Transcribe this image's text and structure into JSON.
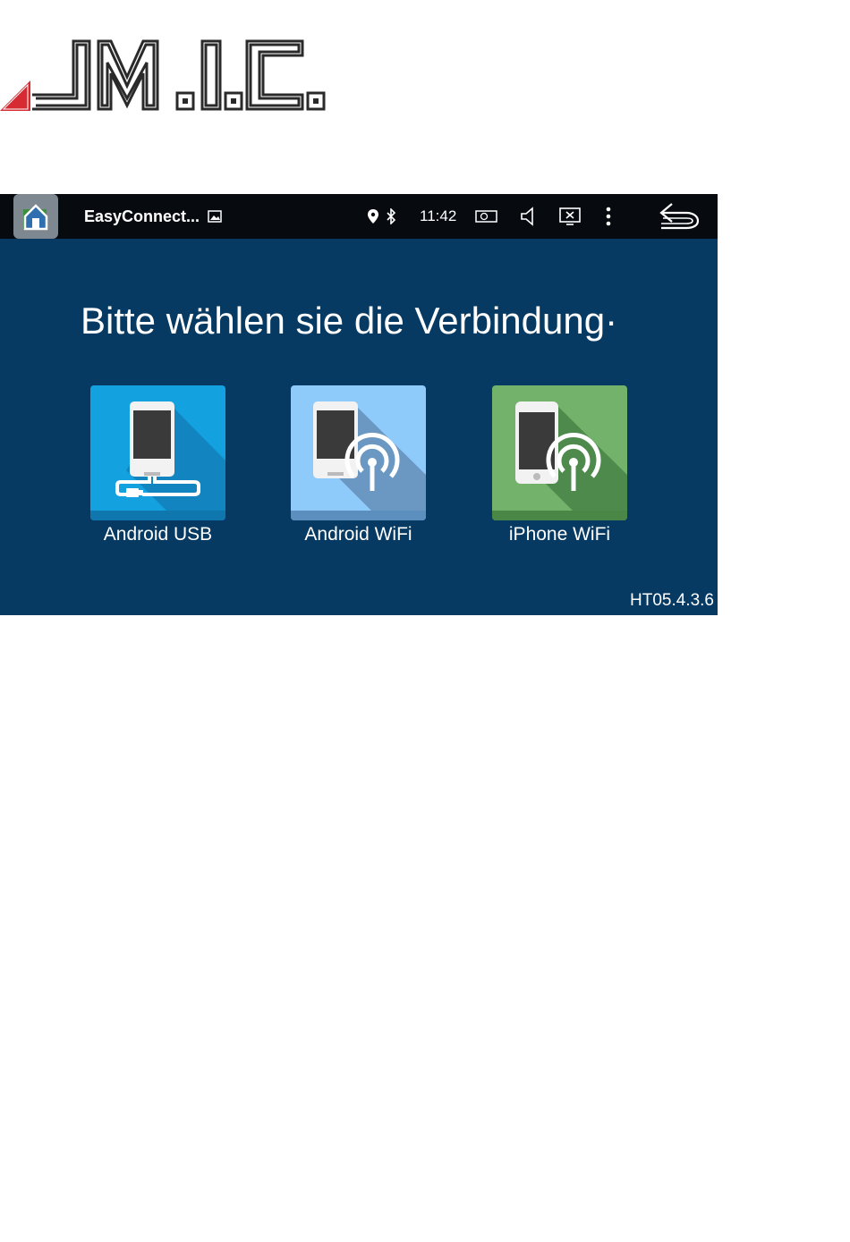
{
  "logo": {
    "text": "M.I.C.",
    "colors": {
      "stripes": "#2a2a2a",
      "triangle": "#d62b32"
    }
  },
  "statusbar": {
    "app_title": "EasyConnect...",
    "time": "11:42",
    "icons": [
      "home-icon",
      "image-icon",
      "location-icon",
      "bluetooth-icon",
      "battery-icon",
      "volume-icon",
      "close-box-icon",
      "more-vert-icon",
      "back-icon"
    ]
  },
  "main": {
    "heading": "Bitte wählen sie die Verbindung·",
    "options": [
      {
        "label": "Android USB",
        "color": "#14a1e0",
        "icon": "android-usb-icon"
      },
      {
        "label": "Android WiFi",
        "color": "#8fcbfa",
        "icon": "android-wifi-icon"
      },
      {
        "label": "iPhone WiFi",
        "color": "#72b26a",
        "icon": "iphone-wifi-icon"
      }
    ],
    "version": "HT05.4.3.6"
  },
  "colors": {
    "background": "#063a62",
    "statusbar": "#070b10"
  }
}
